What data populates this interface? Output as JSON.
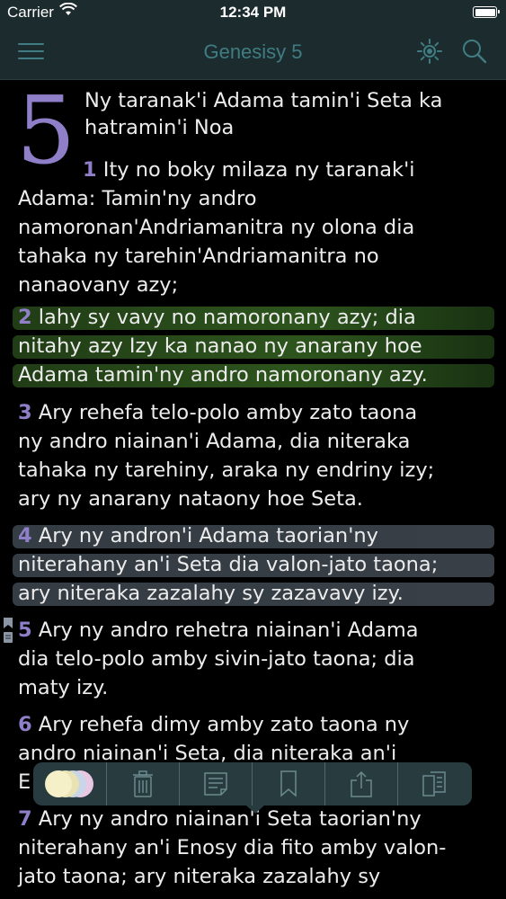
{
  "status_bar": {
    "carrier": "Carrier",
    "time": "12:34 PM",
    "icons": [
      "wifi-icon",
      "battery-icon"
    ]
  },
  "nav_bar": {
    "title": "Genesisy 5",
    "icons": [
      "hamburger-menu-icon",
      "brightness-icon",
      "search-icon"
    ],
    "accent_color": "#3f7d82"
  },
  "chapter": {
    "number": "5",
    "heading_lines": [
      "Ny taranak'i Adama tamin'i Seta ka",
      "hatramin'i Noa"
    ]
  },
  "verses": [
    {
      "num": "1",
      "highlight": "none",
      "lines": [
        " Ity no boky milaza ny taranak'i",
        "Adama: Tamin'ny andro",
        "namoronan'Andriamanitra ny olona dia",
        "tahaka ny tarehin'Andriamanitra no",
        "nanaovany azy;"
      ]
    },
    {
      "num": "2",
      "highlight": "green",
      "lines": [
        " lahy sy vavy no namoronany azy; dia",
        "nitahy azy Izy ka nanao ny anarany hoe",
        "Adama tamin'ny andro namoronany azy."
      ]
    },
    {
      "num": "3",
      "highlight": "none",
      "lines": [
        " Ary rehefa telo-polo amby zato taona",
        "ny andro niainan'i Adama, dia niteraka",
        "tahaka ny tarehiny, araka ny endriny izy;",
        "ary ny anarany nataony hoe Seta."
      ]
    },
    {
      "num": "4",
      "highlight": "gray",
      "lines": [
        " Ary ny andron'i Adama taorian'ny",
        "niterahany an'i Seta dia valon-jato taona;",
        "ary niteraka zazalahy sy zazavavy izy."
      ]
    },
    {
      "num": "5",
      "highlight": "none",
      "lines": [
        " Ary ny andro rehetra niainan'i Adama",
        "dia telo-polo amby sivin-jato taona; dia",
        "maty izy."
      ]
    },
    {
      "num": "6",
      "highlight": "none",
      "lines": [
        " Ary rehefa dimy amby zato taona ny",
        "andro niainan'i Seta, dia niteraka an'i",
        "E"
      ]
    },
    {
      "num": "7",
      "highlight": "none",
      "lines": [
        " Ary ny andro niainan'i Seta taorian'ny",
        "niterahany an'i Enosy dia fito amby valon-",
        "jato taona; ary niteraka zazalahy sy"
      ]
    }
  ],
  "colors": {
    "verse_number": "#8f7fc8",
    "highlight_green": "#46822d",
    "highlight_gray": "#505a64",
    "toolbar_bg": "#2b4044"
  },
  "toolbar": {
    "items": [
      "color-swatches",
      "trash-icon",
      "note-icon",
      "bookmark-icon",
      "share-icon",
      "copy-icon"
    ],
    "swatch_colors": [
      "#f5f0c8",
      "#e9e2b2",
      "#c8d6e8",
      "#e8c8e2"
    ]
  },
  "side_markers": [
    "bookmark-marker-icon",
    "note-marker-icon"
  ]
}
